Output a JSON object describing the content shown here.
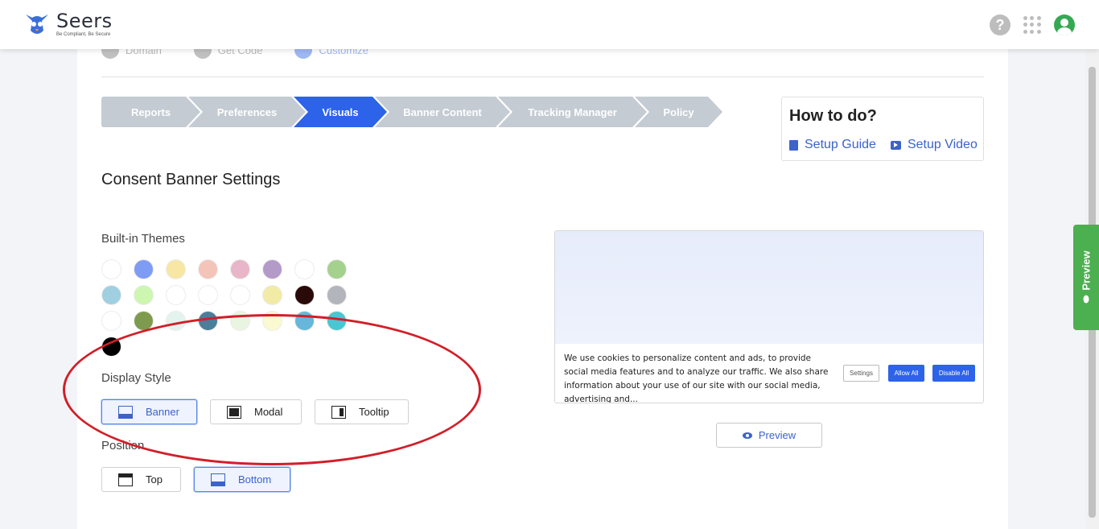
{
  "header": {
    "logo_name": "Seers",
    "logo_tagline": "Be Compliant, Be Secure"
  },
  "steps": [
    {
      "label": "Domain"
    },
    {
      "label": "Get Code"
    },
    {
      "label": "Customize"
    }
  ],
  "nav": {
    "items": [
      "Reports",
      "Preferences",
      "Visuals",
      "Banner Content",
      "Tracking Manager",
      "Policy"
    ],
    "active": "Visuals"
  },
  "howto": {
    "title": "How to do?",
    "setup_guide": "Setup Guide",
    "setup_video": "Setup Video"
  },
  "page_title": "Consent Banner Settings",
  "themes": {
    "label": "Built-in Themes",
    "colors": [
      "#ffffff",
      "#7f9cf5",
      "#f8e7a4",
      "#f4c4b8",
      "#e8b6c8",
      "#b49ac8",
      "#ffffff",
      "#a5d18f",
      "#9fcfe0",
      "#cdf7b0",
      "#ffffff",
      "#ffffff",
      "#ffffff",
      "#f1eba5",
      "#2a0a08",
      "#b4b4bc",
      "#ffffff",
      "#7e9a4e",
      "#e3f4ee",
      "#497f9a",
      "#e9f5e1",
      "#fbf9d0",
      "#66b7da",
      "#4ac6d2",
      "#000000"
    ]
  },
  "display_style": {
    "label": "Display Style",
    "options": [
      "Banner",
      "Modal",
      "Tooltip"
    ],
    "selected": "Banner"
  },
  "position": {
    "label": "Position",
    "options": [
      "Top",
      "Bottom"
    ],
    "selected": "Bottom"
  },
  "banner_preview": {
    "text": "We use cookies to personalize content and ads, to provide social media features and to analyze our traffic. We also share information about your use of our site with our social media, advertising and...",
    "settings_label": "Settings",
    "allow_label": "Allow All",
    "disable_label": "Disable All"
  },
  "preview_button": "Preview",
  "side_tab": "Preview",
  "colors": {
    "accent": "#2d63e8",
    "nav_inactive": "#c4cbd3",
    "side_tab": "#4caf50",
    "annotation": "#d11f2a"
  }
}
